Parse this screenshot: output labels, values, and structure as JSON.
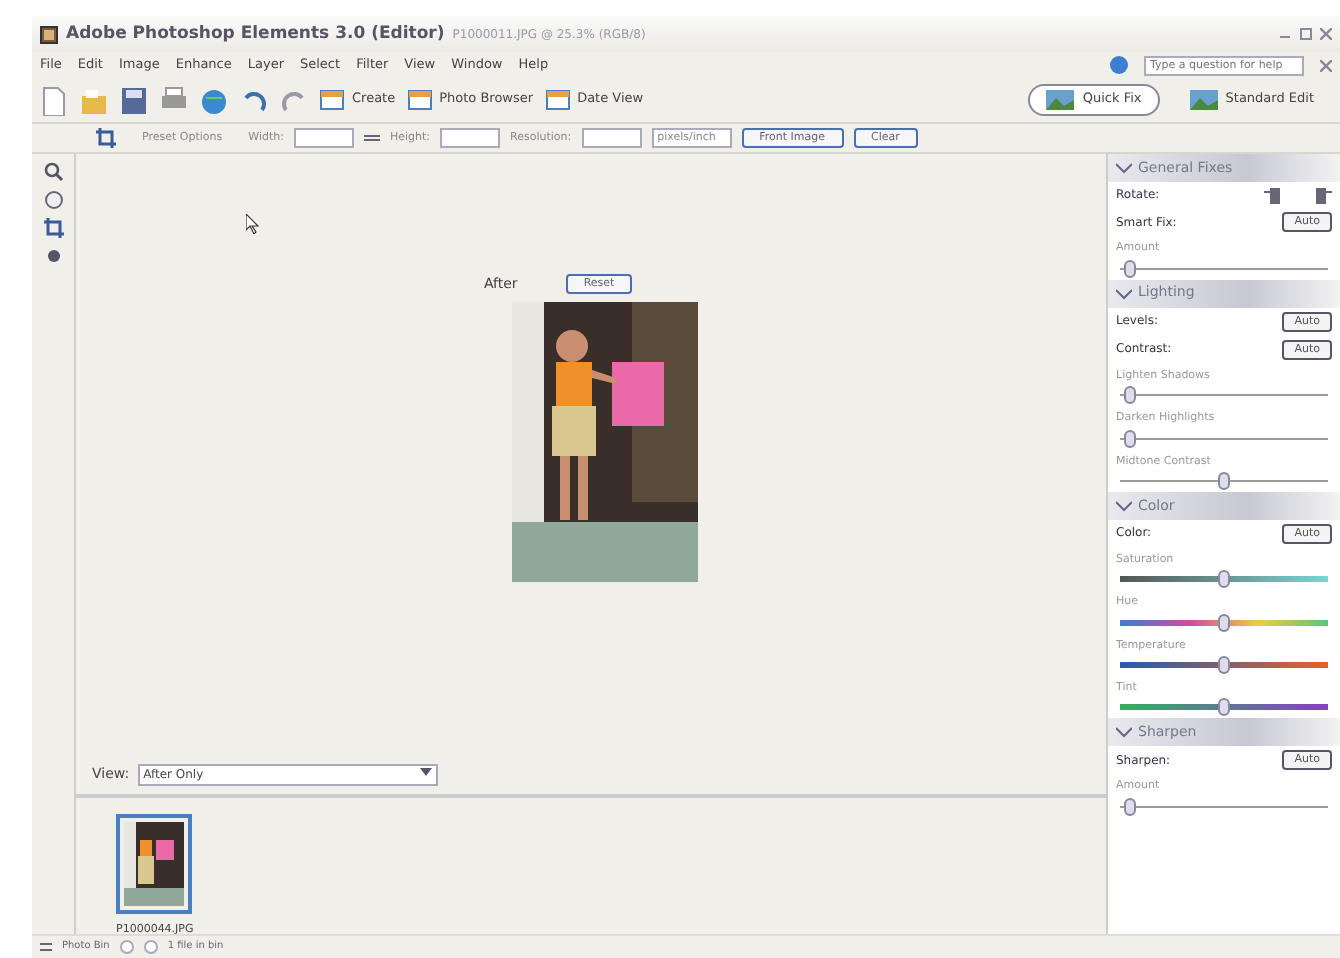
{
  "window": {
    "app_title": "Adobe Photoshop Elements 3.0 (Editor)",
    "document": "P1000011.JPG @ 25.3% (RGB/8)"
  },
  "menu": [
    "File",
    "Edit",
    "Image",
    "Enhance",
    "Layer",
    "Select",
    "Filter",
    "View",
    "Window",
    "Help"
  ],
  "help_field": {
    "placeholder": "Type a question for help"
  },
  "shortcuts": [
    "Create",
    "Photo Browser",
    "Date View"
  ],
  "modes": [
    {
      "label": "Quick Fix",
      "selected": true
    },
    {
      "label": "Standard Edit",
      "selected": false
    }
  ],
  "options_bar": {
    "preset": "Preset Options",
    "width_label": "Width:",
    "height_label": "Height:",
    "resolution_label": "Resolution:",
    "unit": "pixels/inch",
    "buttons": [
      "Front Image",
      "Clear"
    ]
  },
  "canvas": {
    "view_label": "After",
    "reset": "Reset"
  },
  "view": {
    "label": "View:",
    "value": "After Only"
  },
  "bin": {
    "items": [
      {
        "name": "P1000044.JPG",
        "selected": true
      }
    ]
  },
  "status": {
    "bin_label": "Photo Bin",
    "count": "1 file in bin"
  },
  "panels": [
    {
      "title": "General Fixes",
      "rows": [
        {
          "kind": "rotate",
          "label": "Rotate:"
        },
        {
          "kind": "button",
          "label": "Smart Fix:",
          "button": "Auto"
        },
        {
          "kind": "slider",
          "label": "Amount",
          "level": 0.05
        }
      ]
    },
    {
      "title": "Lighting",
      "rows": [
        {
          "kind": "button",
          "label": "Levels:",
          "button": "Auto"
        },
        {
          "kind": "button",
          "label": "Contrast:",
          "button": "Auto"
        },
        {
          "kind": "slider",
          "label": "Lighten Shadows",
          "level": 0.05
        },
        {
          "kind": "slider",
          "label": "Darken Highlights",
          "level": 0.05
        },
        {
          "kind": "slider",
          "label": "Midtone Contrast",
          "level": 0.5
        }
      ]
    },
    {
      "title": "Color",
      "rows": [
        {
          "kind": "button",
          "label": "Color:",
          "button": "Auto"
        },
        {
          "kind": "saturation",
          "label": "Saturation",
          "level": 0.5
        },
        {
          "kind": "hue",
          "label": "Hue",
          "level": 0.5
        },
        {
          "kind": "temperature",
          "label": "Temperature",
          "level": 0.5
        },
        {
          "kind": "tint",
          "label": "Tint",
          "level": 0.5
        }
      ]
    },
    {
      "title": "Sharpen",
      "rows": [
        {
          "kind": "button",
          "label": "Sharpen:",
          "button": "Auto"
        },
        {
          "kind": "slider",
          "label": "Amount",
          "level": 0.05
        }
      ]
    }
  ]
}
